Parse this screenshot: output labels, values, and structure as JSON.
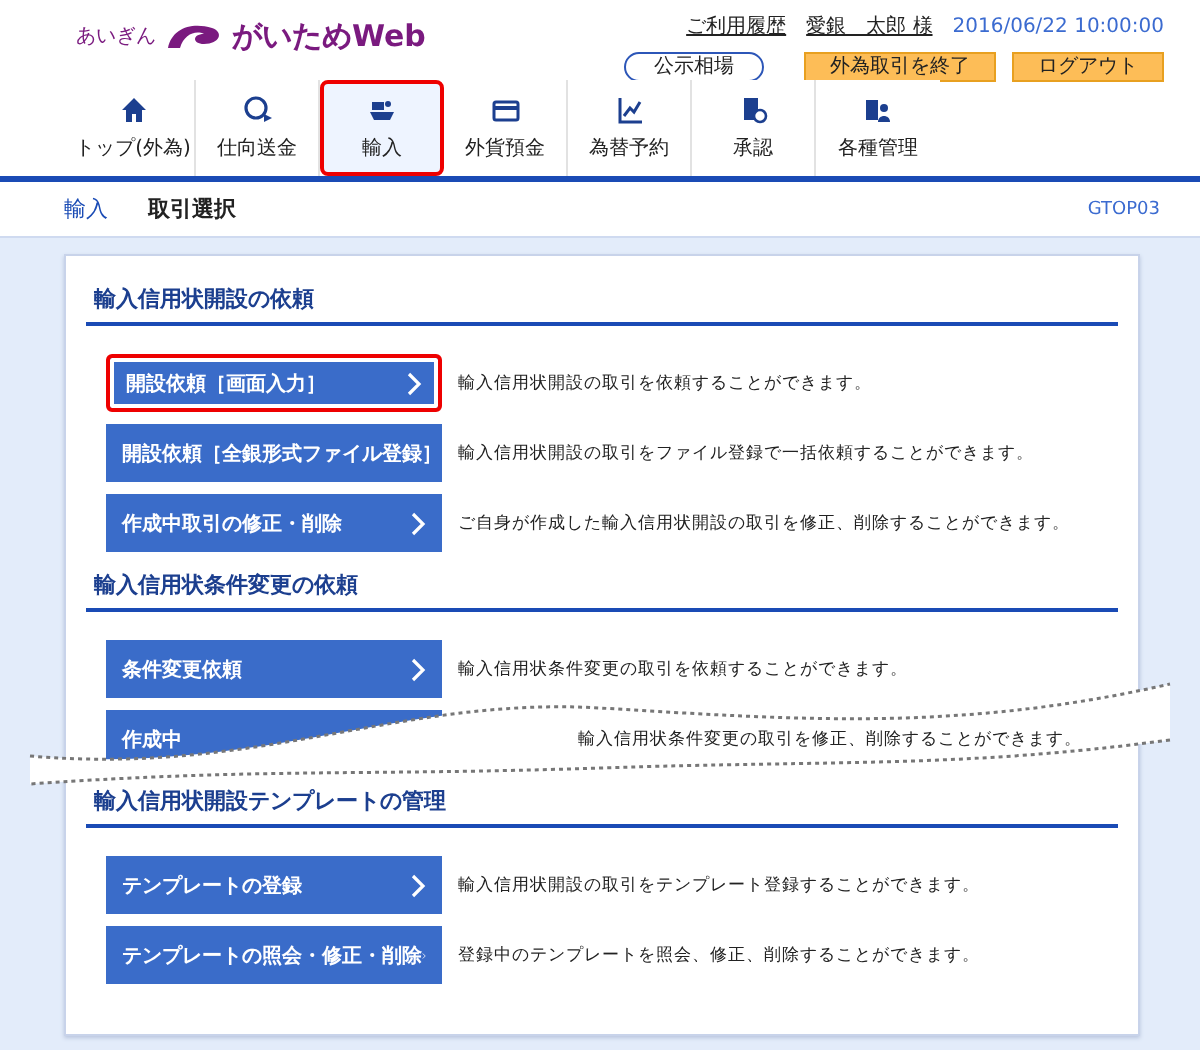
{
  "logo": {
    "bank": "あいぎん",
    "service": "がいためWeb"
  },
  "header": {
    "history_link": "ご利用履歴",
    "user_link": "愛銀　太郎 様",
    "datetime": "2016/06/22 10:00:00"
  },
  "header_buttons": [
    {
      "label": "公示相場",
      "kind": "outline"
    },
    {
      "label": "外為取引を終了",
      "kind": "orange"
    },
    {
      "label": "ログアウト",
      "kind": "orange"
    }
  ],
  "nav": [
    {
      "label": "トップ(外為)",
      "selected": false
    },
    {
      "label": "仕向送金",
      "selected": false
    },
    {
      "label": "輸入",
      "selected": true
    },
    {
      "label": "外貨預金",
      "selected": false
    },
    {
      "label": "為替予約",
      "selected": false
    },
    {
      "label": "承認",
      "selected": false
    },
    {
      "label": "各種管理",
      "selected": false
    }
  ],
  "breadcrumb": {
    "section": "輸入",
    "page": "取引選択",
    "screen_id": "GTOP03"
  },
  "sections": [
    {
      "title": "輸入信用状開設の依頼",
      "actions": [
        {
          "label": "開設依頼［画面入力］",
          "description": "輸入信用状開設の取引を依頼することができます。",
          "highlighted": true
        },
        {
          "label": "開設依頼［全銀形式ファイル登録］",
          "description": "輸入信用状開設の取引をファイル登録で一括依頼することができます。",
          "highlighted": false
        },
        {
          "label": "作成中取引の修正・削除",
          "description": "ご自身が作成した輸入信用状開設の取引を修正、削除することができます。",
          "highlighted": false
        }
      ]
    },
    {
      "title": "輸入信用状条件変更の依頼",
      "actions": [
        {
          "label": "条件変更依頼",
          "description": "輸入信用状条件変更の取引を依頼することができます。",
          "highlighted": false
        },
        {
          "label": "作成中",
          "description": "輸入信用状条件変更の取引を修正、削除することができます。",
          "highlighted": false,
          "torn": true
        }
      ]
    },
    {
      "title": "輸入信用状開設テンプレートの管理",
      "actions": [
        {
          "label": "テンプレートの登録",
          "description": "輸入信用状開設の取引をテンプレート登録することができます。",
          "highlighted": false
        },
        {
          "label": "テンプレートの照会・修正・削除",
          "description": "登録中のテンプレートを照会、修正、削除することができます。",
          "highlighted": false
        }
      ]
    }
  ]
}
